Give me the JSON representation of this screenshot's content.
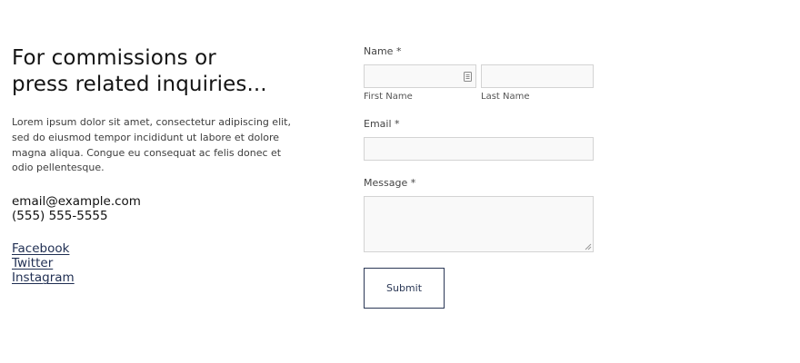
{
  "left": {
    "heading_lines": [
      "For commissions or",
      "press related inquiries..."
    ],
    "body_lines": [
      "Lorem ipsum dolor sit amet, consectetur adipiscing elit,",
      "sed do eiusmod tempor incididunt ut labore et dolore",
      "magna aliqua. Congue eu consequat ac felis donec et",
      "odio pellentesque."
    ],
    "email": "email@example.com",
    "phone": "(555) 555-5555",
    "socials": [
      "Facebook",
      "Twitter",
      "Instagram"
    ]
  },
  "form": {
    "name_label": "Name *",
    "first_name_label": "First Name",
    "last_name_label": "Last Name",
    "email_label": "Email *",
    "message_label": "Message *",
    "submit_label": "Submit",
    "name_field_icon": "contact-card-icon",
    "colors": {
      "button_border": "#2b3856",
      "input_border": "#d3d3d3",
      "input_bg": "#f9f9f9",
      "link": "#1f2e52"
    }
  }
}
